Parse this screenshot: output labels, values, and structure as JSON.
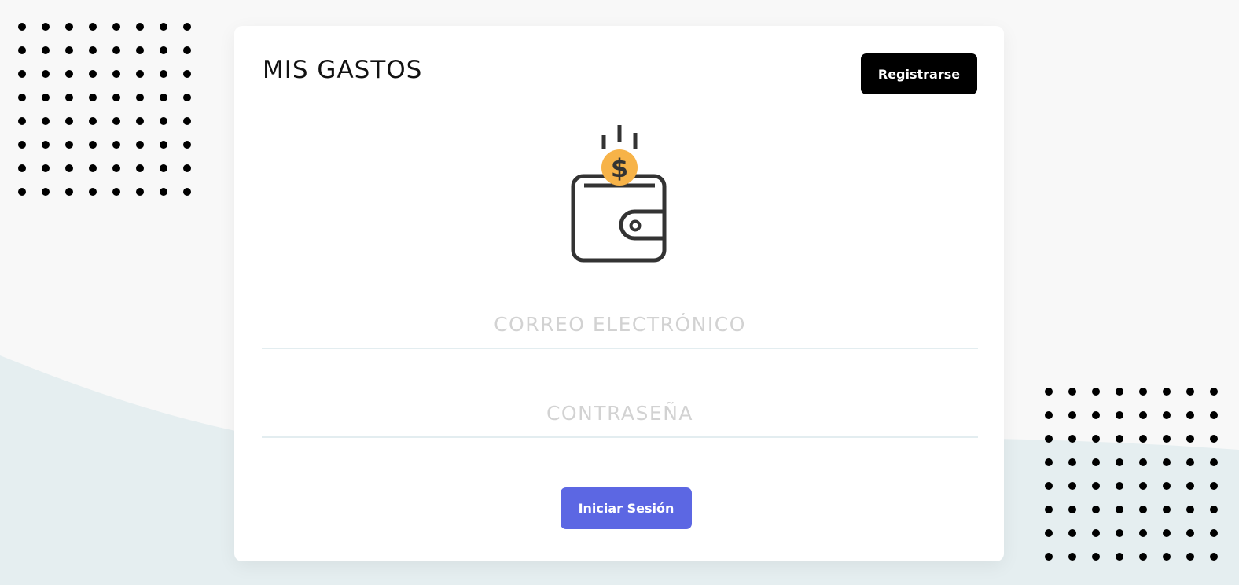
{
  "app": {
    "brand": "MIS GASTOS"
  },
  "header": {
    "register_label": "Registrarse"
  },
  "logo": {
    "icon": "wallet-coin-icon",
    "coin_symbol": "$"
  },
  "form": {
    "email": {
      "placeholder": "CORREO ELECTRÓNICO",
      "value": ""
    },
    "password": {
      "placeholder": "CONTRASEÑA",
      "value": ""
    },
    "login_label": "Iniciar Sesión"
  },
  "colors": {
    "background": "#f8f8f8",
    "wave": "#e5eef0",
    "card": "#ffffff",
    "primary_button": "#5c67e3",
    "register_button": "#000000",
    "coin": "#f7b348",
    "icon_stroke": "#333333",
    "dots": "#000000"
  }
}
